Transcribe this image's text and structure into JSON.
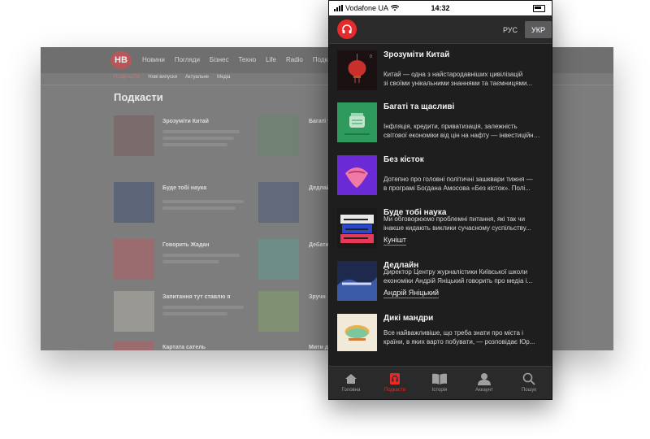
{
  "desktop": {
    "logo": "НВ",
    "nav_items": [
      "Новини",
      "Погляди",
      "Бізнес",
      "Техно",
      "Life",
      "Radio",
      "Подкасти"
    ],
    "sub_items": [
      "ПОДКАСТИ",
      "Нові випуски",
      "Актуальне",
      "Медіа"
    ],
    "page_title": "Подкасти",
    "rows": [
      {
        "title": "Зрозуміти Китай",
        "col2_title": "Багаті та"
      },
      {
        "title": "Буде тобі наука",
        "col2_title": "Дедлайн"
      },
      {
        "title": "Говорить Жадан",
        "col2_title": "Дебати"
      },
      {
        "title": "Запитання тут ставлю я",
        "col2_title": "Зручн"
      },
      {
        "title": "Картата сатель",
        "col2_title": "Мити д"
      }
    ]
  },
  "status_bar": {
    "carrier": "Vodafone UA",
    "time": "14:32"
  },
  "header": {
    "lang_ru": "РУС",
    "lang_uk": "УКР"
  },
  "podcasts": [
    {
      "title": "Зрозуміти Китай",
      "desc1": "Китай — одна з найстародавніших цивілізацій",
      "desc2": "зі своїми унікальними знаннями та таємницями...",
      "author": ""
    },
    {
      "title": "Багаті та щасливі",
      "desc1": "Інфляція, кредити, приватизація, залежність",
      "desc2": "світової економіки від цін на нафту — інвестиційний...",
      "author": ""
    },
    {
      "title": "Без кісток",
      "desc1": "Дотепно про головні політичні зашквари тижня —",
      "desc2": "в програмі Богдана Амосова «Без кісток». Полі...",
      "author": ""
    },
    {
      "title": "Буде тобі наука",
      "desc1": "Ми обговорюємо проблемні питання, які так чи",
      "desc2": "інакше кидають виклики сучасному суспільству...",
      "author": "Кунішт"
    },
    {
      "title": "Дедлайн",
      "desc1": "Директор Центру журналістики Київської школи",
      "desc2": "економіки Андрій Яніцький говорить про медіа і...",
      "author": "Андрій Яніцький"
    },
    {
      "title": "Дикі мандри",
      "desc1": "Все найважливіше, що треба знати про міста і",
      "desc2": "країни, в яких варто побувати, — розповідає Юр...",
      "author": ""
    }
  ],
  "tabs": [
    {
      "label": "Головна",
      "icon": "home-icon"
    },
    {
      "label": "Подкасти",
      "icon": "podcast-icon"
    },
    {
      "label": "Історія",
      "icon": "book-icon"
    },
    {
      "label": "Аккаунт",
      "icon": "user-icon"
    },
    {
      "label": "Пошук",
      "icon": "search-icon"
    }
  ],
  "colors": {
    "accent": "#e42a2a",
    "phone_bg": "#1e1e1f"
  }
}
